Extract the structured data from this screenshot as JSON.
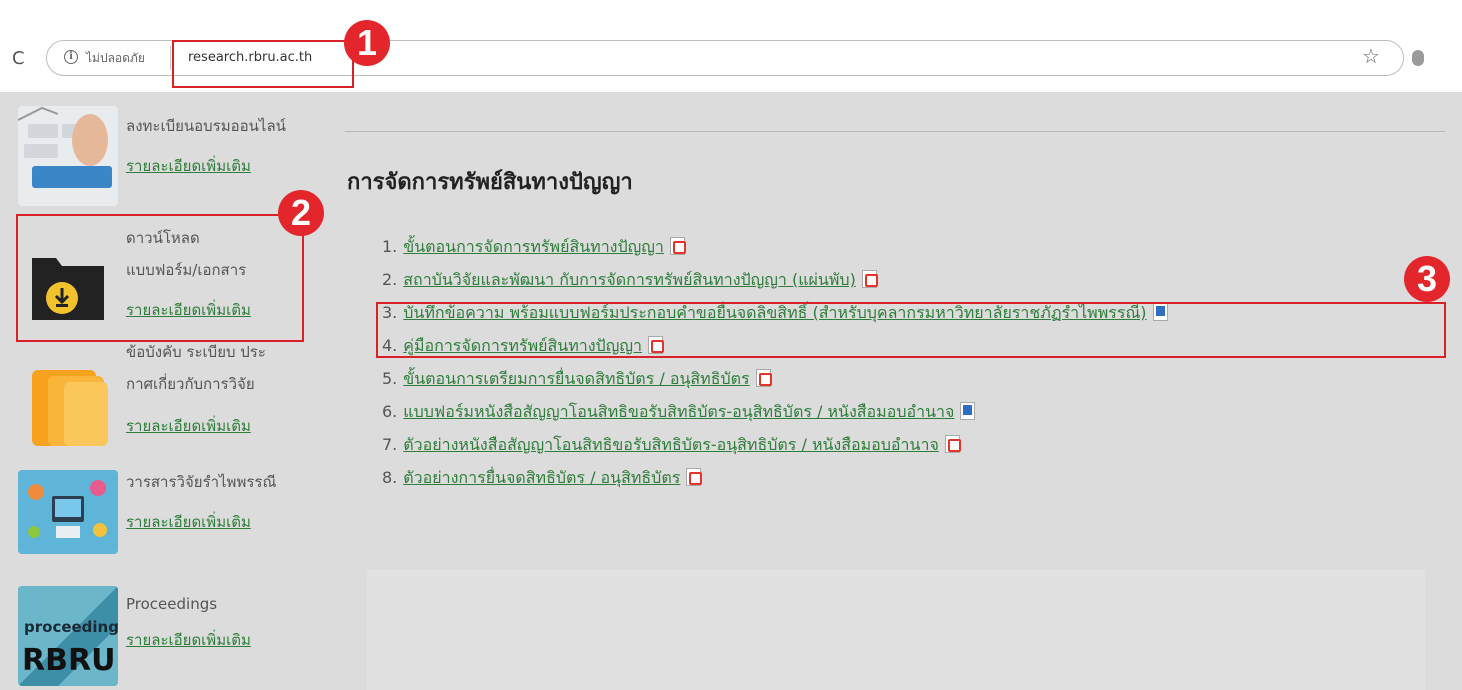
{
  "browser": {
    "insecure_label": "ไม่ปลอดภัย",
    "url": "research.rbru.ac.th"
  },
  "callouts": [
    "1",
    "2",
    "3"
  ],
  "sidebar": {
    "items": [
      {
        "title": "ลงทะเบียนอบรมออนไลน์",
        "link": "รายละเอียดเพิ่มเติม",
        "icon": "keyboard-register-icon"
      },
      {
        "title_lines": [
          "ดาวน์โหลด",
          "แบบฟอร์ม/เอกสาร"
        ],
        "link": "รายละเอียดเพิ่มเติม",
        "icon": "download-folder-icon"
      },
      {
        "title_lines": [
          "ข้อบังคับ ระเบียบ ประ",
          "กาศเกี่ยวกับการวิจัย"
        ],
        "link": "รายละเอียดเพิ่มเติม",
        "icon": "folders-icon"
      },
      {
        "title": "วารสารวิจัยรำไพพรรณี",
        "link": "รายละเอียดเพิ่มเติม",
        "icon": "journal-icon"
      },
      {
        "title": "Proceedings",
        "link": "รายละเอียดเพิ่มเติม",
        "icon": "proceedings-logo",
        "logo_lines": [
          "proceedings",
          "RBRU"
        ]
      }
    ]
  },
  "main": {
    "title": "การจัดการทรัพย์สินทางปัญญา",
    "items": [
      {
        "num": "1.",
        "text": "ขั้นตอนการจัดการทรัพย์สินทางปัญญา",
        "file": "pdf"
      },
      {
        "num": "2.",
        "text": "สถาบันวิจัยและพัฒนา กับการจัดการทรัพย์สินทางปัญญา (แผ่นพับ)",
        "file": "pdf"
      },
      {
        "num": "3.",
        "text": "บันทึกข้อความ พร้อมแบบฟอร์มประกอบคำขอยื่นจดลิขสิทธิ์ (สำหรับบุคลากรมหาวิทยาลัยราชภัฏรำไพพรรณี)",
        "file": "doc"
      },
      {
        "num": "4.",
        "text": "คู่มือการจัดการทรัพย์สินทางปัญญา",
        "file": "pdf"
      },
      {
        "num": "5.",
        "text": "ขั้นตอนการเตรียมการยื่นจดสิทธิบัตร / อนุสิทธิบัตร",
        "file": "pdf"
      },
      {
        "num": "6.",
        "text": "แบบฟอร์มหนังสือสัญญาโอนสิทธิขอรับสิทธิบัตร-อนุสิทธิบัตร / หนังสือมอบอำนาจ",
        "file": "doc"
      },
      {
        "num": "7.",
        "text": "ตัวอย่างหนังสือสัญญาโอนสิทธิขอรับสิทธิบัตร-อนุสิทธิบัตร / หนังสือมอบอำนาจ",
        "file": "pdf"
      },
      {
        "num": "8.",
        "text": "ตัวอย่างการยื่นจดสิทธิบัตร / อนุสิทธิบัตร",
        "file": "pdf"
      }
    ]
  },
  "colors": {
    "link": "#2e7d3a",
    "callout": "#e3262b",
    "highlight": "#d92228"
  }
}
